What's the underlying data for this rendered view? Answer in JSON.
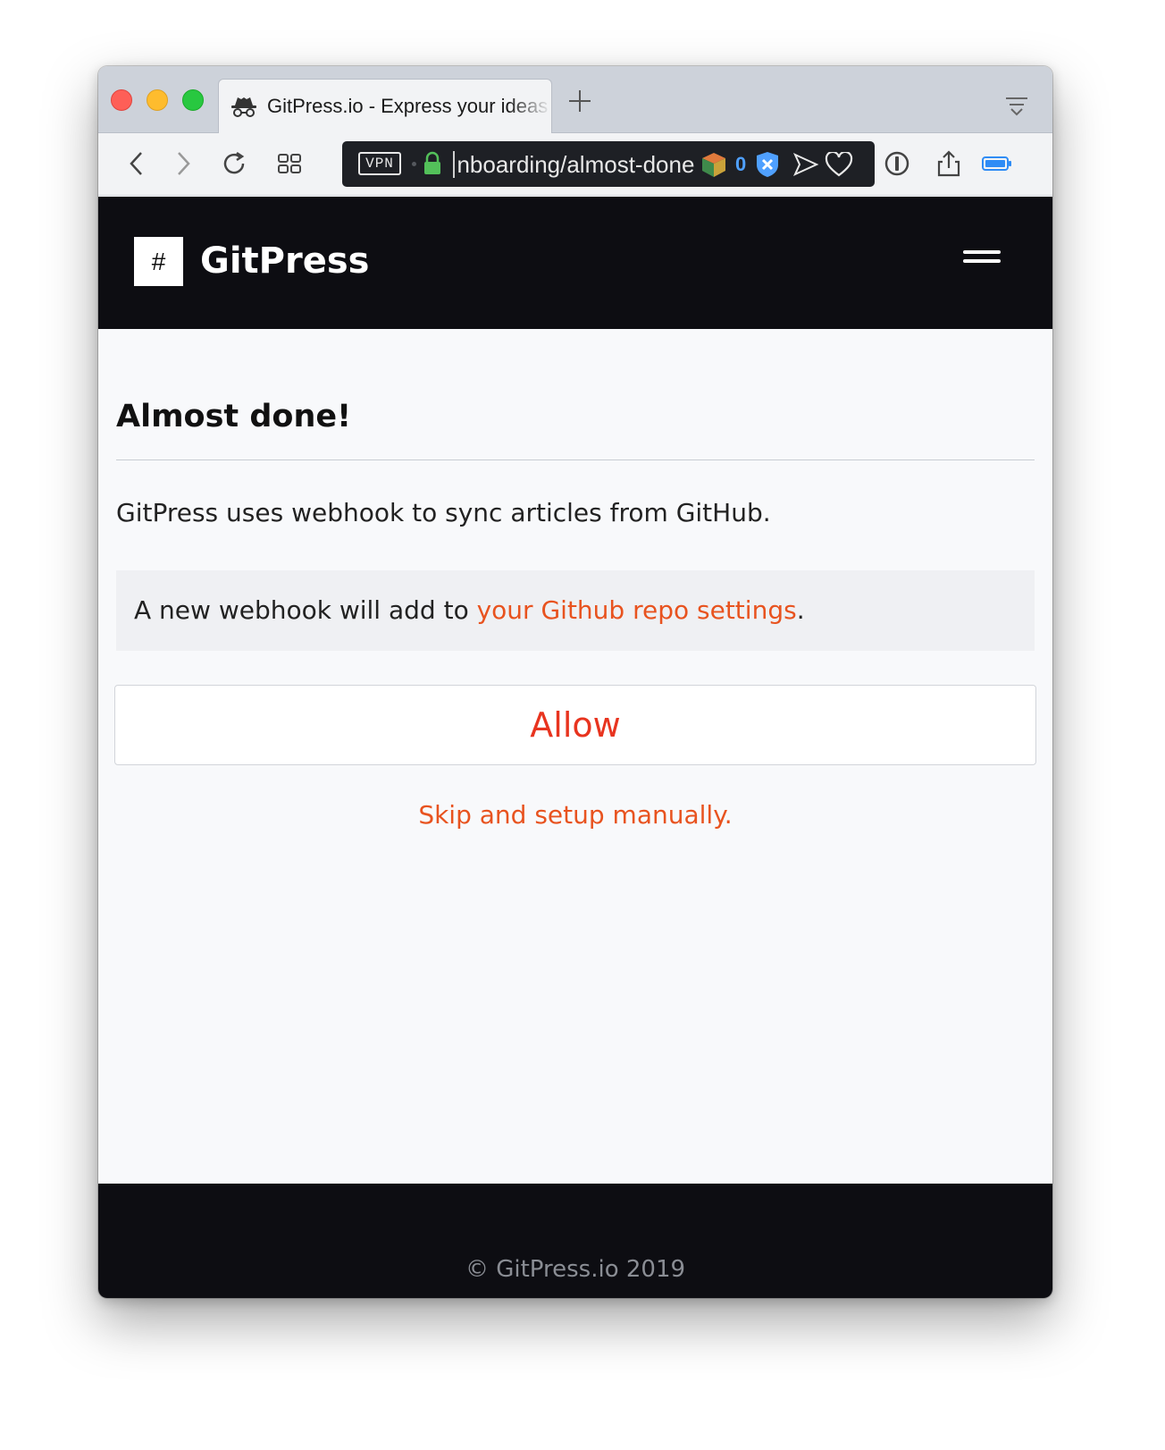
{
  "browser": {
    "tab_title": "GitPress.io - Express your ideas",
    "url_display": "onboarding/almost-done",
    "vpn_label": "VPN",
    "extension_badge_count": "0",
    "accent_color": "#4fa0ff"
  },
  "site": {
    "brand": "GitPress",
    "logo_symbol": "#"
  },
  "page": {
    "title": "Almost done!",
    "intro": "GitPress uses webhook to sync articles from GitHub.",
    "notice_prefix": "A new webhook will add to ",
    "notice_link": "your Github repo settings",
    "notice_suffix": ".",
    "allow_button": "Allow",
    "skip_link": "Skip and setup manually."
  },
  "footer": {
    "copyright": "© GitPress.io 2019"
  },
  "colors": {
    "header_bg": "#0d0d12",
    "link": "#e8531f",
    "button_text": "#e8341f"
  }
}
